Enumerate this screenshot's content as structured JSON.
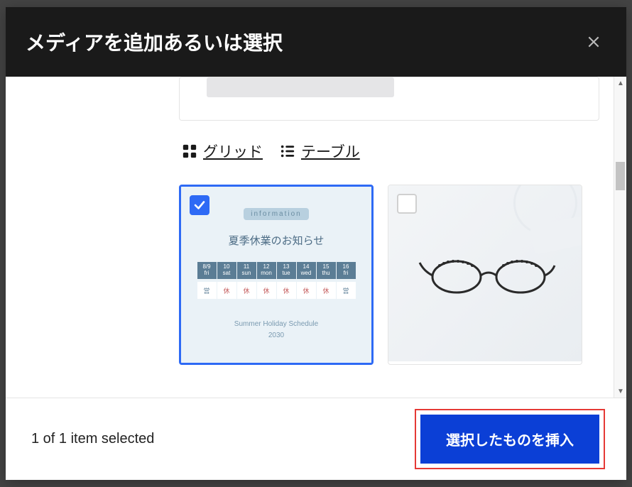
{
  "header": {
    "title": "メディアを追加あるいは選択"
  },
  "view_switch": {
    "grid_label": "グリッド",
    "table_label": "テーブル"
  },
  "items": [
    {
      "selected": true,
      "poster": {
        "info": "information",
        "title": "夏季休業のお知らせ",
        "calendar_head": [
          {
            "date": "8/9",
            "dow": "fri"
          },
          {
            "date": "10",
            "dow": "sat"
          },
          {
            "date": "11",
            "dow": "sun"
          },
          {
            "date": "12",
            "dow": "mon"
          },
          {
            "date": "13",
            "dow": "tue"
          },
          {
            "date": "14",
            "dow": "wed"
          },
          {
            "date": "15",
            "dow": "thu"
          },
          {
            "date": "16",
            "dow": "fri"
          }
        ],
        "calendar_body": [
          "営",
          "休",
          "休",
          "休",
          "休",
          "休",
          "休",
          "営"
        ],
        "subtitle_line1": "Summer Holiday Schedule",
        "subtitle_line2": "2030"
      }
    },
    {
      "selected": false,
      "thumb_kind": "glasses"
    }
  ],
  "footer": {
    "selection_text": "1 of 1 item selected",
    "insert_label": "選択したものを挿入"
  }
}
